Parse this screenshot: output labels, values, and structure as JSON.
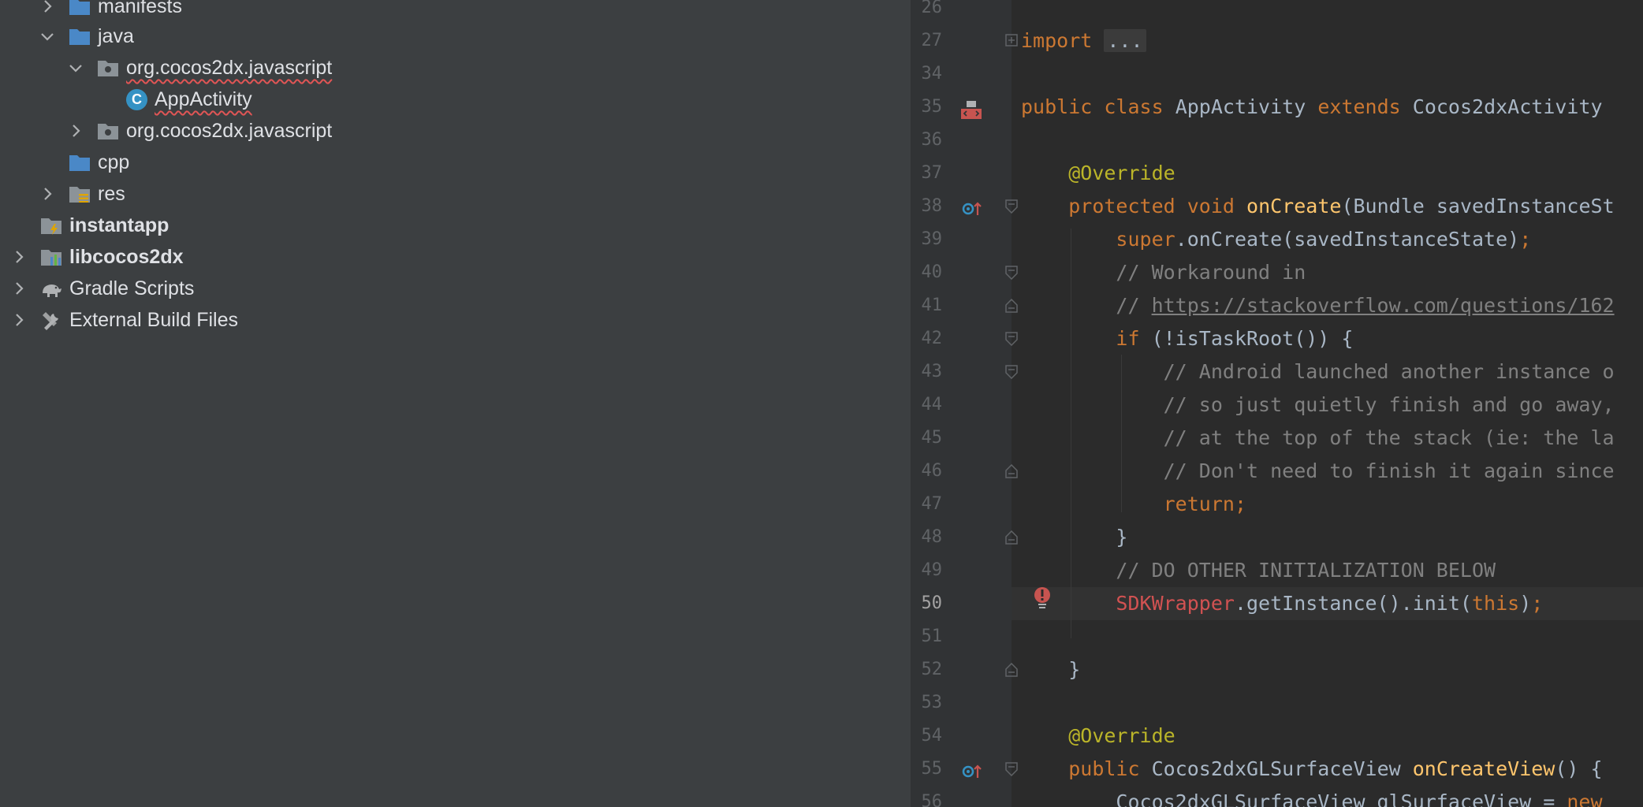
{
  "tree": {
    "items": [
      {
        "label": "manifests",
        "chevron": "right",
        "icon": "folder-blue"
      },
      {
        "label": "java",
        "chevron": "down",
        "icon": "folder-blue"
      },
      {
        "label": "org.cocos2dx.javascript",
        "chevron": "down",
        "icon": "package-folder"
      },
      {
        "label": "AppActivity",
        "chevron": "none",
        "icon": "class-badge",
        "badge": "C"
      },
      {
        "label": "org.cocos2dx.javascript",
        "chevron": "right",
        "icon": "package-folder"
      },
      {
        "label": "cpp",
        "chevron": "none",
        "icon": "folder-blue"
      },
      {
        "label": "res",
        "chevron": "right",
        "icon": "resources-folder"
      },
      {
        "label": "instantapp",
        "chevron": "none",
        "icon": "module-folder-instant"
      },
      {
        "label": "libcocos2dx",
        "chevron": "right",
        "icon": "module-folder-library"
      },
      {
        "label": "Gradle Scripts",
        "chevron": "right",
        "icon": "gradle-elephant"
      },
      {
        "label": "External Build Files",
        "chevron": "right",
        "icon": "build-tools"
      }
    ]
  },
  "editor": {
    "current_line": "50",
    "lines": [
      {
        "num": "26",
        "text": ""
      },
      {
        "num": "27",
        "kw": "import",
        "folded": "..."
      },
      {
        "num": "34",
        "text": ""
      },
      {
        "num": "35",
        "a": "public",
        "b": "class",
        "c": "AppActivity",
        "d": "extends",
        "e": "Cocos2dxActivity"
      },
      {
        "num": "36",
        "text": ""
      },
      {
        "num": "37",
        "annotation": "@Override"
      },
      {
        "num": "38",
        "a": "protected",
        "b": "void",
        "fn": "onCreate",
        "rest": "(Bundle savedInstanceSt"
      },
      {
        "num": "39",
        "kw": "super",
        "rest": ".onCreate(savedInstanceState);",
        "semi": ";"
      },
      {
        "num": "40",
        "comment": "// Workaround in"
      },
      {
        "num": "41",
        "comment": "// ",
        "link": "https://stackoverflow.com/questions/162"
      },
      {
        "num": "42",
        "kw": "if",
        "rest": " (!isTaskRoot()) {"
      },
      {
        "num": "43",
        "comment": "// Android launched another instance o"
      },
      {
        "num": "44",
        "comment": "// so just quietly finish and go away,"
      },
      {
        "num": "45",
        "comment": "// at the top of the stack (ie: the la"
      },
      {
        "num": "46",
        "comment": "// Don't need to finish it again since"
      },
      {
        "num": "47",
        "kw": "return",
        "semi": ";"
      },
      {
        "num": "48",
        "text": "}"
      },
      {
        "num": "49",
        "comment": "// DO OTHER INITIALIZATION BELOW"
      },
      {
        "num": "50",
        "err": "SDKWrapper",
        "rest": ".getInstance().init(",
        "kw": "this",
        "tail": ");"
      },
      {
        "num": "51",
        "text": ""
      },
      {
        "num": "52",
        "text": "}"
      },
      {
        "num": "53",
        "text": ""
      },
      {
        "num": "54",
        "annotation": "@Override"
      },
      {
        "num": "55",
        "a": "public",
        "type": "Cocos2dxGLSurfaceView",
        "fn": "onCreateView",
        "rest": "() {"
      },
      {
        "num": "56",
        "rest": "Cocos2dxGLSurfaceView glSurfaceView = ",
        "kw": "new"
      }
    ]
  },
  "colors": {
    "tree_bg": "#3c3f41",
    "editor_bg": "#2b2b2b",
    "gutter_bg": "#313335",
    "keyword": "#cc7832",
    "annotation": "#bbb529",
    "function": "#ffc66d",
    "comment": "#808080",
    "error": "#d25252",
    "folder": "#4a88c7"
  }
}
